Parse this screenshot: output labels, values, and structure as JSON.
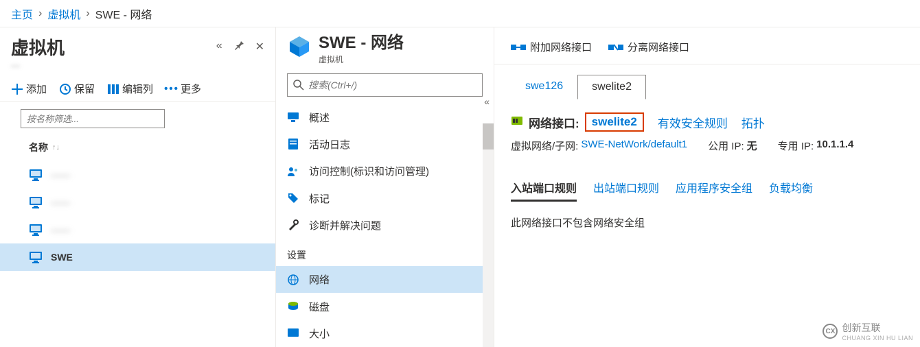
{
  "breadcrumb": {
    "home": "主页",
    "vms": "虚拟机",
    "current": "SWE - 网络"
  },
  "leftPanel": {
    "title": "虚拟机",
    "subtitle": "—",
    "toolbar": {
      "add": "添加",
      "reserve": "保留",
      "editCols": "编辑列",
      "more": "更多"
    },
    "filterPlaceholder": "按名称筛选...",
    "columnHeader": "名称",
    "items": [
      {
        "name": "——",
        "blur": true
      },
      {
        "name": "——",
        "blur": true
      },
      {
        "name": "——",
        "blur": true
      },
      {
        "name": "SWE",
        "blur": false,
        "selected": true
      }
    ]
  },
  "midPanel": {
    "title": "SWE - 网络",
    "subtitle": "虚拟机",
    "searchPlaceholder": "搜索(Ctrl+/)",
    "nav": {
      "overview": "概述",
      "activityLog": "活动日志",
      "accessControl": "访问控制(标识和访问管理)",
      "tags": "标记",
      "diagnose": "诊断并解决问题",
      "sectionSettings": "设置",
      "network": "网络",
      "disks": "磁盘",
      "size": "大小"
    }
  },
  "rightPanel": {
    "actions": {
      "attach": "附加网络接口",
      "detach": "分离网络接口"
    },
    "tabs": {
      "t1": "swe126",
      "t2": "swelite2"
    },
    "nic": {
      "label": "网络接口:",
      "name": "swelite2",
      "secRules": "有效安全规则",
      "topology": "拓扑"
    },
    "vnet": {
      "label": "虚拟网络/子网:",
      "value": "SWE-NetWork/default1"
    },
    "publicIp": {
      "label": "公用 IP:",
      "value": "无"
    },
    "privateIp": {
      "label": "专用 IP:",
      "value": "10.1.1.4"
    },
    "subtabs": {
      "inbound": "入站端口规则",
      "outbound": "出站端口规则",
      "asg": "应用程序安全组",
      "lb": "负载均衡"
    },
    "emptyMsg": "此网络接口不包含网络安全组"
  },
  "watermark": {
    "main": "创新互联",
    "sub": "CHUANG XIN HU LIAN"
  },
  "colors": {
    "accent": "#0078d4",
    "highlight": "#d83b01"
  }
}
